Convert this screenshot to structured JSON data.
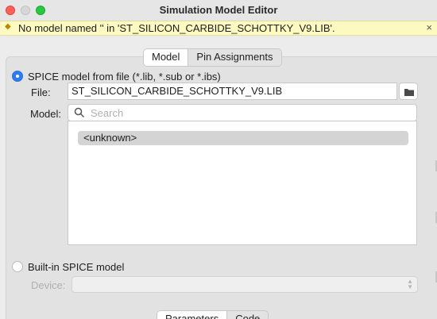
{
  "window": {
    "title": "Simulation Model Editor"
  },
  "infobar": {
    "message": "No model named '' in 'ST_SILICON_CARBIDE_SCHOTTKY_V9.LIB'.",
    "close_glyph": "×"
  },
  "tabs": [
    {
      "label": "Model",
      "active": true
    },
    {
      "label": "Pin Assignments",
      "active": false
    }
  ],
  "source": {
    "spice_file_option": "SPICE model from file (*.lib, *.sub or *.ibs)",
    "file_label": "File:",
    "file_value": "ST_SILICON_CARBIDE_SCHOTTKY_V9.LIB",
    "model_label": "Model:",
    "search_placeholder": "Search",
    "models": [
      "<unknown>"
    ],
    "builtin_option": "Built-in SPICE model",
    "device_label": "Device:"
  },
  "bottom_tabs": [
    {
      "label": "Parameters",
      "active": true
    },
    {
      "label": "Code",
      "active": false
    }
  ],
  "icons": {
    "folder": "folder-icon",
    "search": "search-icon",
    "info": "lightbulb-icon"
  },
  "colors": {
    "accent": "#2f7bf5",
    "infobar_bg": "#fdfac1"
  }
}
